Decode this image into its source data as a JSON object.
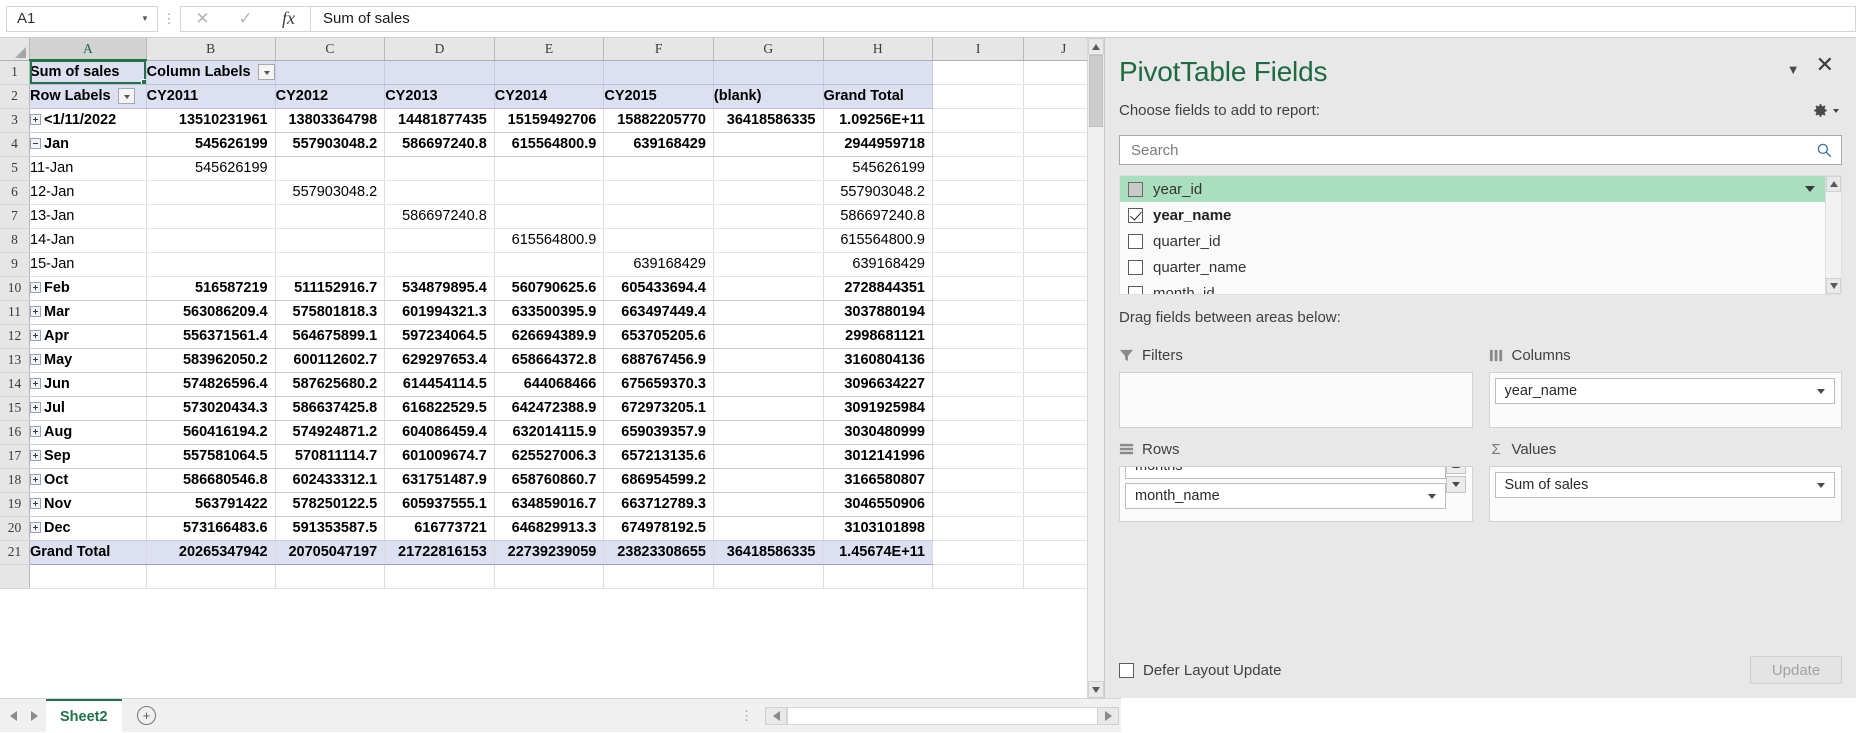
{
  "formula_bar": {
    "name_box_value": "A1",
    "cancel_icon": "close-icon",
    "confirm_icon": "check-icon",
    "function_icon": "fx",
    "content": "Sum of sales"
  },
  "grid": {
    "column_headers": [
      "A",
      "B",
      "C",
      "D",
      "E",
      "F",
      "G",
      "H",
      "I",
      "J"
    ],
    "selected_cell": "A1",
    "row_numbers": [
      "1",
      "2",
      "3",
      "4",
      "5",
      "6",
      "7",
      "8",
      "9",
      "10",
      "11",
      "12",
      "13",
      "14",
      "15",
      "16",
      "17",
      "18",
      "19",
      "20",
      "21"
    ],
    "r1": {
      "a": "Sum of sales",
      "b": "Column Labels"
    },
    "r2": {
      "label": "Row Labels",
      "cols": [
        "CY2011",
        "CY2012",
        "CY2013",
        "CY2014",
        "CY2015",
        "(blank)",
        "Grand Total"
      ]
    },
    "rows": [
      {
        "num": "3",
        "label": "<1/11/2022",
        "btn": "plus",
        "indent": 0,
        "bold": true,
        "pivot": true,
        "values": [
          "13510231961",
          "13803364798",
          "14481877435",
          "15159492706",
          "15882205770",
          "36418586335",
          "1.09256E+11"
        ]
      },
      {
        "num": "4",
        "label": "Jan",
        "btn": "minus",
        "indent": 0,
        "bold": true,
        "pivot": true,
        "values": [
          "545626199",
          "557903048.2",
          "586697240.8",
          "615564800.9",
          "639168429",
          "",
          "2944959718"
        ]
      },
      {
        "num": "5",
        "label": "11-Jan",
        "btn": "none",
        "indent": 1,
        "bold": false,
        "pivot": false,
        "values": [
          "545626199",
          "",
          "",
          "",
          "",
          "",
          "545626199"
        ]
      },
      {
        "num": "6",
        "label": "12-Jan",
        "btn": "none",
        "indent": 1,
        "bold": false,
        "pivot": false,
        "values": [
          "",
          "557903048.2",
          "",
          "",
          "",
          "",
          "557903048.2"
        ]
      },
      {
        "num": "7",
        "label": "13-Jan",
        "btn": "none",
        "indent": 1,
        "bold": false,
        "pivot": false,
        "values": [
          "",
          "",
          "586697240.8",
          "",
          "",
          "",
          "586697240.8"
        ]
      },
      {
        "num": "8",
        "label": "14-Jan",
        "btn": "none",
        "indent": 1,
        "bold": false,
        "pivot": false,
        "values": [
          "",
          "",
          "",
          "615564800.9",
          "",
          "",
          "615564800.9"
        ]
      },
      {
        "num": "9",
        "label": "15-Jan",
        "btn": "none",
        "indent": 1,
        "bold": false,
        "pivot": false,
        "values": [
          "",
          "",
          "",
          "",
          "639168429",
          "",
          "639168429"
        ]
      },
      {
        "num": "10",
        "label": "Feb",
        "btn": "plus",
        "indent": 0,
        "bold": true,
        "pivot": true,
        "values": [
          "516587219",
          "511152916.7",
          "534879895.4",
          "560790625.6",
          "605433694.4",
          "",
          "2728844351"
        ]
      },
      {
        "num": "11",
        "label": "Mar",
        "btn": "plus",
        "indent": 0,
        "bold": true,
        "pivot": true,
        "values": [
          "563086209.4",
          "575801818.3",
          "601994321.3",
          "633500395.9",
          "663497449.4",
          "",
          "3037880194"
        ]
      },
      {
        "num": "12",
        "label": "Apr",
        "btn": "plus",
        "indent": 0,
        "bold": true,
        "pivot": true,
        "values": [
          "556371561.4",
          "564675899.1",
          "597234064.5",
          "626694389.9",
          "653705205.6",
          "",
          "2998681121"
        ]
      },
      {
        "num": "13",
        "label": "May",
        "btn": "plus",
        "indent": 0,
        "bold": true,
        "pivot": true,
        "values": [
          "583962050.2",
          "600112602.7",
          "629297653.4",
          "658664372.8",
          "688767456.9",
          "",
          "3160804136"
        ]
      },
      {
        "num": "14",
        "label": "Jun",
        "btn": "plus",
        "indent": 0,
        "bold": true,
        "pivot": true,
        "values": [
          "574826596.4",
          "587625680.2",
          "614454114.5",
          "644068466",
          "675659370.3",
          "",
          "3096634227"
        ]
      },
      {
        "num": "15",
        "label": "Jul",
        "btn": "plus",
        "indent": 0,
        "bold": true,
        "pivot": true,
        "values": [
          "573020434.3",
          "586637425.8",
          "616822529.5",
          "642472388.9",
          "672973205.1",
          "",
          "3091925984"
        ]
      },
      {
        "num": "16",
        "label": "Aug",
        "btn": "plus",
        "indent": 0,
        "bold": true,
        "pivot": true,
        "values": [
          "560416194.2",
          "574924871.2",
          "604086459.4",
          "632014115.9",
          "659039357.9",
          "",
          "3030480999"
        ]
      },
      {
        "num": "17",
        "label": "Sep",
        "btn": "plus",
        "indent": 0,
        "bold": true,
        "pivot": true,
        "values": [
          "557581064.5",
          "570811114.7",
          "601009674.7",
          "625527006.3",
          "657213135.6",
          "",
          "3012141996"
        ]
      },
      {
        "num": "18",
        "label": "Oct",
        "btn": "plus",
        "indent": 0,
        "bold": true,
        "pivot": true,
        "values": [
          "586680546.8",
          "602433312.1",
          "631751487.9",
          "658760860.7",
          "686954599.2",
          "",
          "3166580807"
        ]
      },
      {
        "num": "19",
        "label": "Nov",
        "btn": "plus",
        "indent": 0,
        "bold": true,
        "pivot": true,
        "values": [
          "563791422",
          "578250122.5",
          "605937555.1",
          "634859016.7",
          "663712789.3",
          "",
          "3046550906"
        ]
      },
      {
        "num": "20",
        "label": "Dec",
        "btn": "plus",
        "indent": 0,
        "bold": true,
        "pivot": true,
        "values": [
          "573166483.6",
          "591353587.5",
          "616773721",
          "646829913.3",
          "674978192.5",
          "",
          "3103101898"
        ]
      }
    ],
    "grand_total": {
      "num": "21",
      "label": "Grand Total",
      "values": [
        "20265347942",
        "20705047197",
        "21722816153",
        "22739239059",
        "23823308655",
        "36418586335",
        "1.45674E+11"
      ]
    }
  },
  "sheet_bar": {
    "tabs": [
      "Sheet2"
    ],
    "add_sheet_label": "+",
    "nav_prev_icon": "triangle-left-icon",
    "nav_next_icon": "triangle-right-icon"
  },
  "pivot_panel": {
    "title": "PivotTable Fields",
    "collapse_icon": "chevron-down-icon",
    "close_icon": "close-icon",
    "choose_label": "Choose fields to add to report:",
    "tools_icon": "gear-icon",
    "search": {
      "placeholder": "Search",
      "value": "",
      "icon": "search-icon"
    },
    "fields": [
      {
        "name": "year_id",
        "checked": false,
        "highlighted": true,
        "grayed_check": true
      },
      {
        "name": "year_name",
        "checked": true,
        "highlighted": false,
        "grayed_check": false
      },
      {
        "name": "quarter_id",
        "checked": false,
        "highlighted": false,
        "grayed_check": false
      },
      {
        "name": "quarter_name",
        "checked": false,
        "highlighted": false,
        "grayed_check": false
      },
      {
        "name": "month_id",
        "checked": false,
        "highlighted": false,
        "grayed_check": false
      }
    ],
    "drag_label": "Drag fields between areas below:",
    "areas": [
      {
        "key": "filters",
        "title": "Filters",
        "icon": "filter-icon",
        "items": []
      },
      {
        "key": "columns",
        "title": "Columns",
        "icon": "columns-icon",
        "items": [
          "year_name"
        ]
      },
      {
        "key": "rows",
        "title": "Rows",
        "icon": "rows-icon",
        "items": [
          "months",
          "month_name"
        ]
      },
      {
        "key": "values",
        "title": "Values",
        "icon": "sigma-icon",
        "items": [
          "Sum of sales"
        ]
      }
    ],
    "defer_label": "Defer Layout Update",
    "defer_checked": false,
    "update_label": "Update"
  }
}
